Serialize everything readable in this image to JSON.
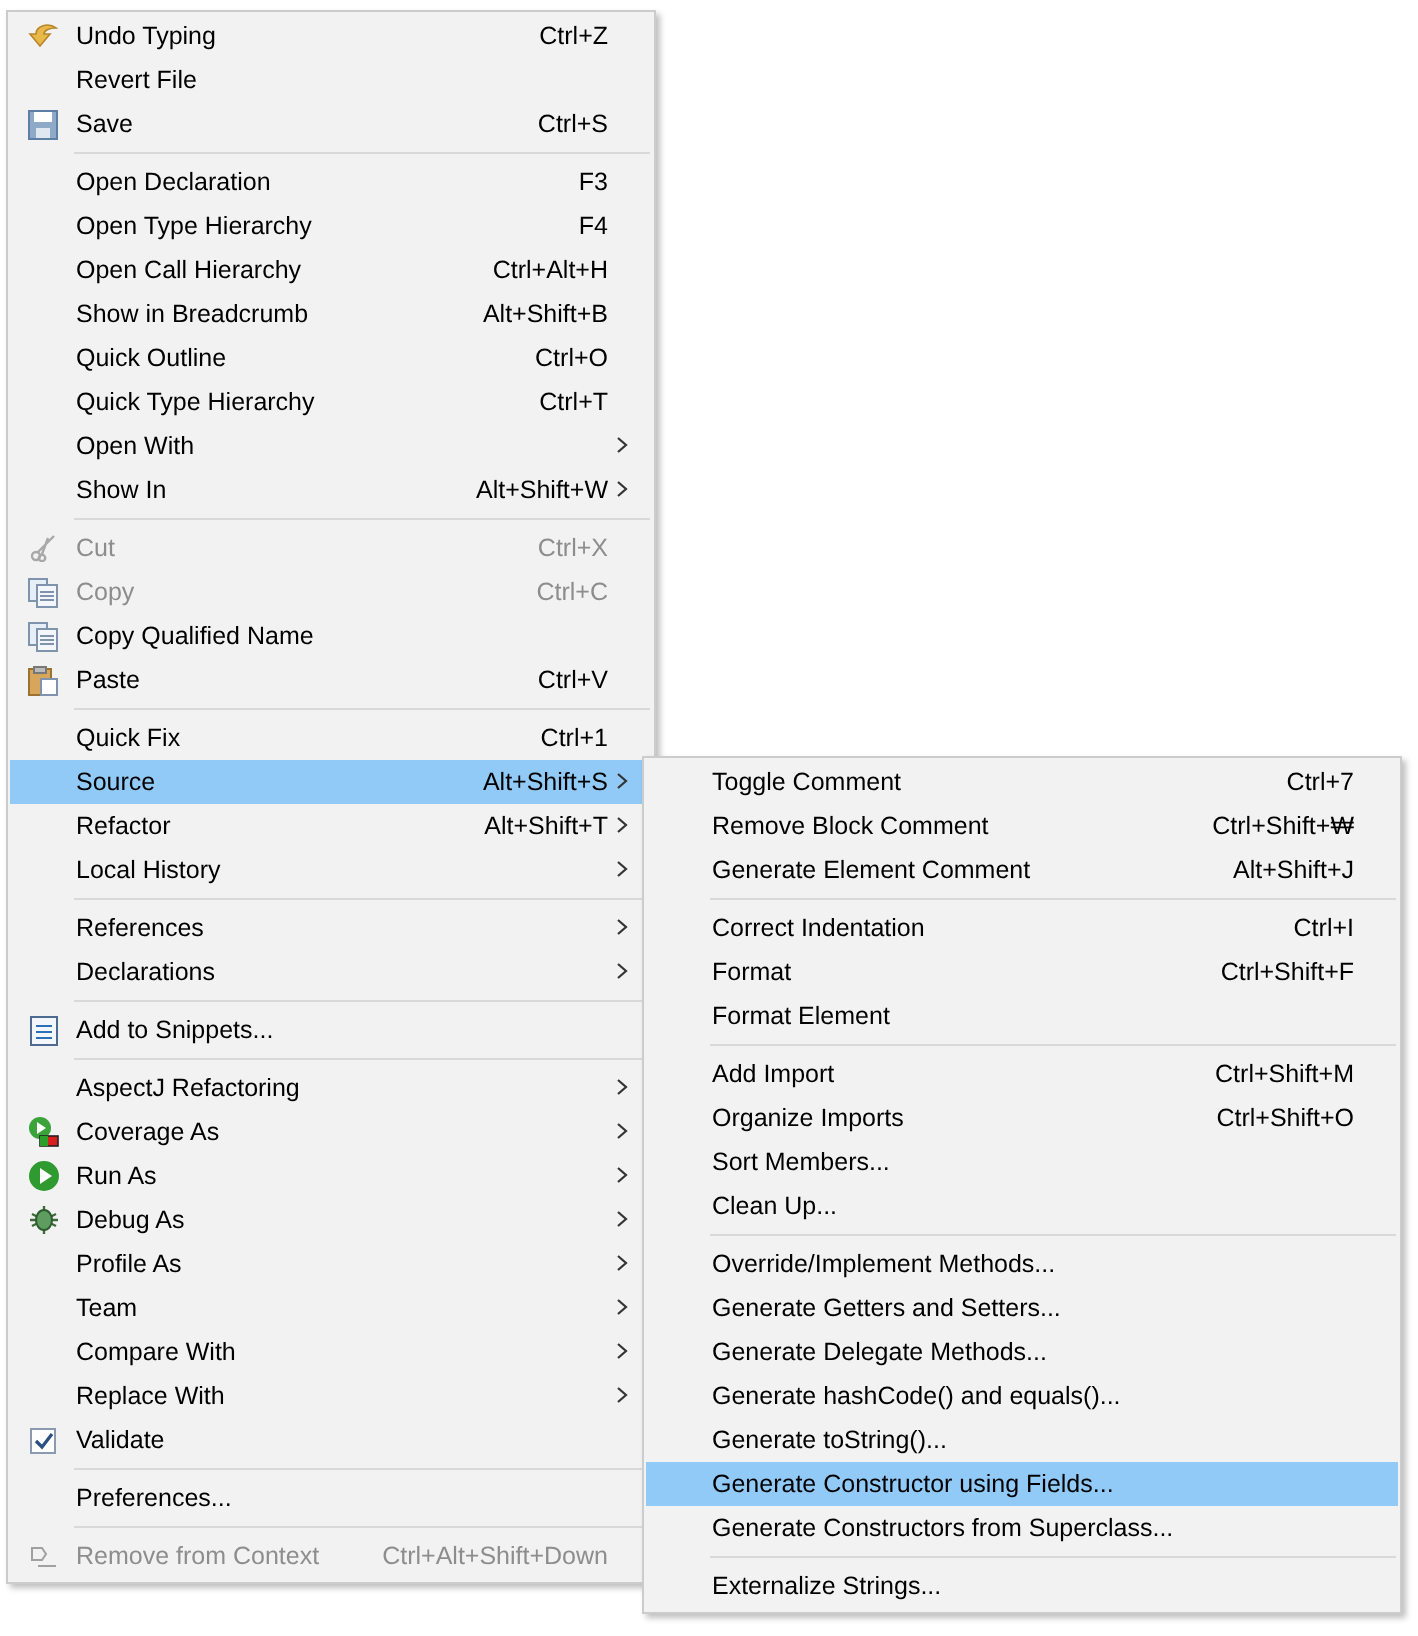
{
  "context_menu": {
    "groups": [
      [
        {
          "label": "Undo Typing",
          "shortcut": "Ctrl+Z",
          "kind": "undo",
          "submenu": false,
          "disabled": false,
          "selected": false
        },
        {
          "label": "Revert File",
          "submenu": false,
          "disabled": false,
          "selected": false
        },
        {
          "label": "Save",
          "shortcut": "Ctrl+S",
          "kind": "save",
          "submenu": false,
          "disabled": false,
          "selected": false
        }
      ],
      [
        {
          "label": "Open Declaration",
          "shortcut": "F3",
          "submenu": false,
          "disabled": false,
          "selected": false
        },
        {
          "label": "Open Type Hierarchy",
          "shortcut": "F4",
          "submenu": false,
          "disabled": false,
          "selected": false
        },
        {
          "label": "Open Call Hierarchy",
          "shortcut": "Ctrl+Alt+H",
          "submenu": false,
          "disabled": false,
          "selected": false
        },
        {
          "label": "Show in Breadcrumb",
          "shortcut": "Alt+Shift+B",
          "submenu": false,
          "disabled": false,
          "selected": false
        },
        {
          "label": "Quick Outline",
          "shortcut": "Ctrl+O",
          "submenu": false,
          "disabled": false,
          "selected": false
        },
        {
          "label": "Quick Type Hierarchy",
          "shortcut": "Ctrl+T",
          "submenu": false,
          "disabled": false,
          "selected": false
        },
        {
          "label": "Open With",
          "submenu": true,
          "disabled": false,
          "selected": false
        },
        {
          "label": "Show In",
          "shortcut": "Alt+Shift+W",
          "submenu": true,
          "disabled": false,
          "selected": false
        }
      ],
      [
        {
          "label": "Cut",
          "shortcut": "Ctrl+X",
          "kind": "cut",
          "submenu": false,
          "disabled": true,
          "selected": false
        },
        {
          "label": "Copy",
          "shortcut": "Ctrl+C",
          "kind": "copy",
          "submenu": false,
          "disabled": true,
          "selected": false
        },
        {
          "label": "Copy Qualified Name",
          "kind": "copy",
          "submenu": false,
          "disabled": false,
          "selected": false
        },
        {
          "label": "Paste",
          "shortcut": "Ctrl+V",
          "kind": "paste",
          "submenu": false,
          "disabled": false,
          "selected": false
        }
      ],
      [
        {
          "label": "Quick Fix",
          "shortcut": "Ctrl+1",
          "submenu": false,
          "disabled": false,
          "selected": false
        },
        {
          "label": "Source",
          "shortcut": "Alt+Shift+S",
          "submenu": true,
          "disabled": false,
          "selected": true
        },
        {
          "label": "Refactor",
          "shortcut": "Alt+Shift+T",
          "submenu": true,
          "disabled": false,
          "selected": false
        },
        {
          "label": "Local History",
          "submenu": true,
          "disabled": false,
          "selected": false
        }
      ],
      [
        {
          "label": "References",
          "submenu": true,
          "disabled": false,
          "selected": false
        },
        {
          "label": "Declarations",
          "submenu": true,
          "disabled": false,
          "selected": false
        }
      ],
      [
        {
          "label": "Add to Snippets...",
          "kind": "snippets",
          "submenu": false,
          "disabled": false,
          "selected": false
        }
      ],
      [
        {
          "label": "AspectJ Refactoring",
          "submenu": true,
          "disabled": false,
          "selected": false
        },
        {
          "label": "Coverage As",
          "kind": "coverage",
          "submenu": true,
          "disabled": false,
          "selected": false
        },
        {
          "label": "Run As",
          "kind": "run",
          "submenu": true,
          "disabled": false,
          "selected": false
        },
        {
          "label": "Debug As",
          "kind": "debug",
          "submenu": true,
          "disabled": false,
          "selected": false
        },
        {
          "label": "Profile As",
          "submenu": true,
          "disabled": false,
          "selected": false
        },
        {
          "label": "Team",
          "submenu": true,
          "disabled": false,
          "selected": false
        },
        {
          "label": "Compare With",
          "submenu": true,
          "disabled": false,
          "selected": false
        },
        {
          "label": "Replace With",
          "submenu": true,
          "disabled": false,
          "selected": false
        },
        {
          "label": "Validate",
          "checked": true,
          "submenu": false,
          "disabled": false,
          "selected": false
        }
      ],
      [
        {
          "label": "Preferences...",
          "submenu": false,
          "disabled": false,
          "selected": false
        }
      ],
      [
        {
          "label": "Remove from Context",
          "shortcut": "Ctrl+Alt+Shift+Down",
          "kind": "context",
          "submenu": false,
          "disabled": true,
          "selected": false
        }
      ]
    ]
  },
  "source_submenu": {
    "groups": [
      [
        {
          "label": "Toggle Comment",
          "shortcut": "Ctrl+7",
          "selected": false
        },
        {
          "label": "Remove Block Comment",
          "shortcut": "Ctrl+Shift+₩",
          "selected": false
        },
        {
          "label": "Generate Element Comment",
          "shortcut": "Alt+Shift+J",
          "selected": false
        }
      ],
      [
        {
          "label": "Correct Indentation",
          "shortcut": "Ctrl+I",
          "selected": false
        },
        {
          "label": "Format",
          "shortcut": "Ctrl+Shift+F",
          "selected": false
        },
        {
          "label": "Format Element",
          "selected": false
        }
      ],
      [
        {
          "label": "Add Import",
          "shortcut": "Ctrl+Shift+M",
          "selected": false
        },
        {
          "label": "Organize Imports",
          "shortcut": "Ctrl+Shift+O",
          "selected": false
        },
        {
          "label": "Sort Members...",
          "selected": false
        },
        {
          "label": "Clean Up...",
          "selected": false
        }
      ],
      [
        {
          "label": "Override/Implement Methods...",
          "selected": false
        },
        {
          "label": "Generate Getters and Setters...",
          "selected": false
        },
        {
          "label": "Generate Delegate Methods...",
          "selected": false
        },
        {
          "label": "Generate hashCode() and equals()...",
          "selected": false
        },
        {
          "label": "Generate toString()...",
          "selected": false
        },
        {
          "label": "Generate Constructor using Fields...",
          "selected": true
        },
        {
          "label": "Generate Constructors from Superclass...",
          "selected": false
        }
      ],
      [
        {
          "label": "Externalize Strings...",
          "selected": false
        }
      ]
    ]
  }
}
